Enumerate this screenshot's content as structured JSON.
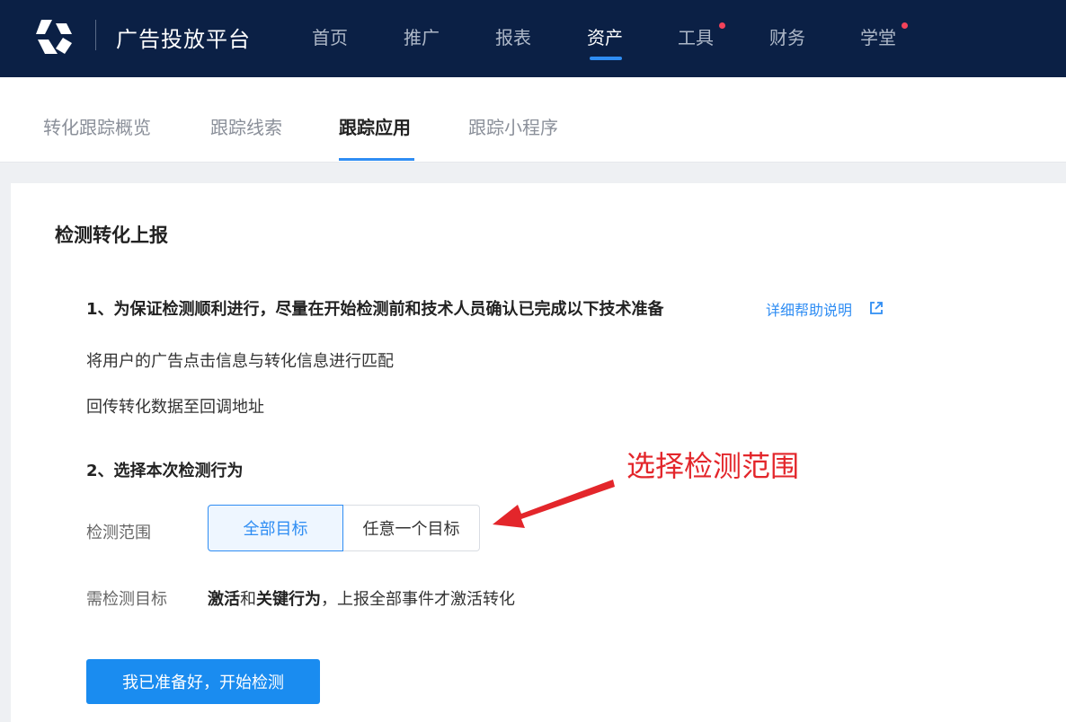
{
  "header": {
    "title": "广告投放平台",
    "nav": [
      {
        "label": "首页"
      },
      {
        "label": "推广"
      },
      {
        "label": "报表"
      },
      {
        "label": "资产",
        "active": true
      },
      {
        "label": "工具",
        "dot": true
      },
      {
        "label": "财务"
      },
      {
        "label": "学堂",
        "dot": true
      }
    ]
  },
  "subtabs": [
    {
      "label": "转化跟踪概览"
    },
    {
      "label": "跟踪线索"
    },
    {
      "label": "跟踪应用",
      "active": true
    },
    {
      "label": "跟踪小程序"
    }
  ],
  "card": {
    "title": "检测转化上报",
    "step1": "1、为保证检测顺利进行，尽量在开始检测前和技术人员确认已完成以下技术准备",
    "help_link": "详细帮助说明",
    "info_items": [
      "将用户的广告点击信息与转化信息进行匹配",
      "回传转化数据至回调地址"
    ],
    "step2": "2、选择本次检测行为",
    "range_label": "检测范围",
    "range_options": [
      "全部目标",
      "任意一个目标"
    ],
    "range_selected": "全部目标",
    "target_label": "需检测目标",
    "target_value": {
      "bold1": "激活",
      "mid": "和",
      "bold2": "关键行为",
      "rest": "，上报全部事件才激活转化"
    },
    "start_button": "我已准备好，开始检测"
  },
  "annotation": {
    "text": "选择检测范围",
    "color": "#e3262b"
  },
  "colors": {
    "header_bg": "#0b2045",
    "accent": "#2f8df3",
    "notification_dot": "#f2425a"
  }
}
